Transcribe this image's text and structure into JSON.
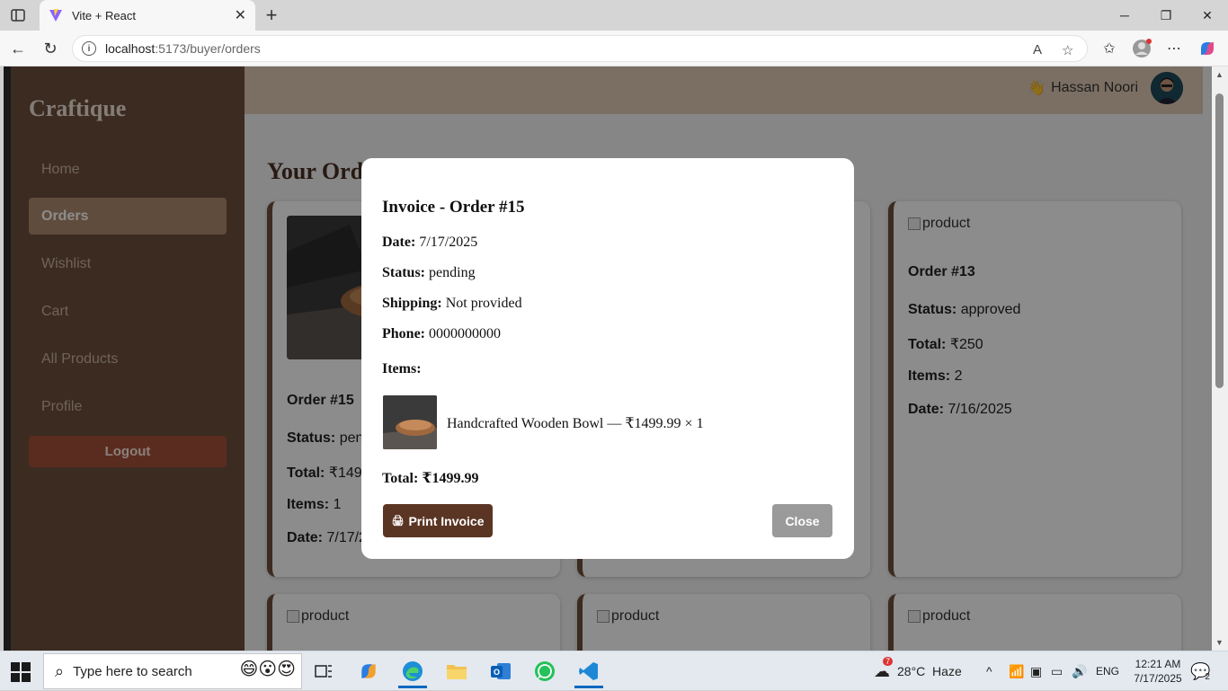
{
  "browser": {
    "tab_title": "Vite + React",
    "url_host": "localhost",
    "url_rest": ":5173/buyer/orders"
  },
  "sidebar": {
    "brand": "Craftique",
    "items": [
      {
        "label": "Home"
      },
      {
        "label": "Orders"
      },
      {
        "label": "Wishlist"
      },
      {
        "label": "Cart"
      },
      {
        "label": "All Products"
      },
      {
        "label": "Profile"
      }
    ],
    "logout_label": "Logout"
  },
  "header": {
    "wave_icon": "👋",
    "user_name": "Hassan Noori"
  },
  "page": {
    "title": "Your Orders"
  },
  "orders": [
    {
      "order_label": "Order #15",
      "status_label": "Status:",
      "status": "pending",
      "total_label": "Total:",
      "total": "₹1499.99",
      "items_label": "Items:",
      "items": "1",
      "date_label": "Date:",
      "date": "7/17/2025"
    },
    {
      "order_label": "Order #13",
      "status_label": "Status:",
      "status": "approved",
      "total_label": "Total:",
      "total": "₹250",
      "items_label": "Items:",
      "items": "2",
      "date_label": "Date:",
      "date": "7/16/2025",
      "image_alt": "product"
    }
  ],
  "bottom_cards": [
    {
      "image_alt": "product"
    },
    {
      "image_alt": "product"
    },
    {
      "image_alt": "product"
    }
  ],
  "modal": {
    "title": "Invoice - Order #15",
    "date_label": "Date:",
    "date": "7/17/2025",
    "status_label": "Status:",
    "status": "pending",
    "shipping_label": "Shipping:",
    "shipping": "Not provided",
    "phone_label": "Phone:",
    "phone": "0000000000",
    "items_label": "Items:",
    "line_item": "Handcrafted Wooden Bowl — ₹1499.99 × 1",
    "total_label": "Total:",
    "total": "₹1499.99",
    "print_label": "Print Invoice",
    "print_icon": "🖨",
    "close_label": "Close"
  },
  "taskbar": {
    "search_placeholder": "Type here to search",
    "weather": "28°C  Haze",
    "weather_badge": "7",
    "language": "ENG",
    "time": "12:21 AM",
    "date": "7/17/2025",
    "notification_count": "2"
  }
}
